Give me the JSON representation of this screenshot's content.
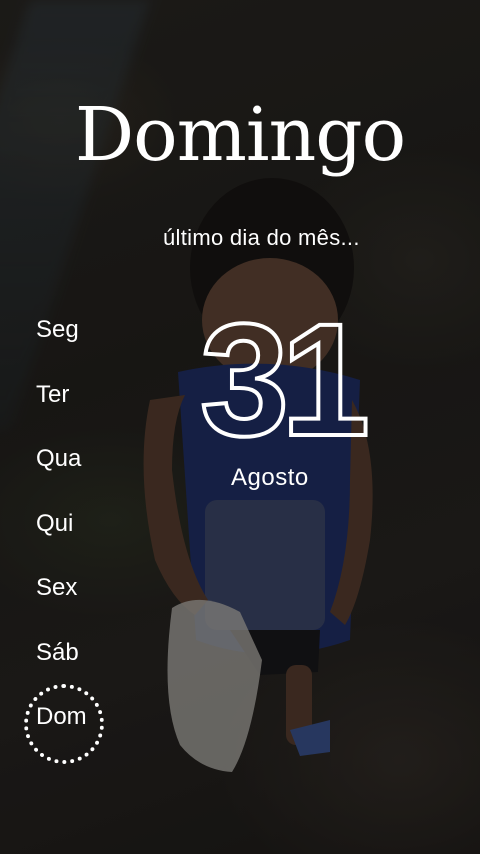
{
  "header": {
    "title": "Domingo",
    "subtitle": "último dia do mês..."
  },
  "date": {
    "day": "31",
    "month": "Agosto"
  },
  "weekdays": [
    {
      "label": "Seg"
    },
    {
      "label": "Ter"
    },
    {
      "label": "Qua"
    },
    {
      "label": "Qui"
    },
    {
      "label": "Sex"
    },
    {
      "label": "Sáb"
    },
    {
      "label": "Dom"
    }
  ],
  "active_weekday": "Dom",
  "colors": {
    "text": "#ffffff",
    "background": "#1b1b1a"
  }
}
